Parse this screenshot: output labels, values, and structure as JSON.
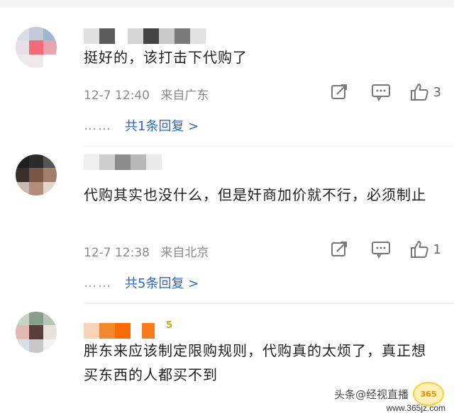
{
  "comments": [
    {
      "text": "挺好的，该打击下代购了",
      "time": "12-7 12:40",
      "location": "来自广东",
      "likes": "3",
      "reply_text": "共1条回复 >"
    },
    {
      "text": "代购其实也没什么，但是奸商加价就不行，必须制止",
      "time": "12-7 12:38",
      "location": "来自北京",
      "likes": "1",
      "reply_text": "共5条回复 >"
    },
    {
      "text": "胖东来应该制定限购规则，代购真的太烦了，真正想买东西的人都买不到",
      "badge": "5"
    }
  ],
  "reply_dots": "……",
  "watermark": {
    "text": "头条@经视直播",
    "url": "www.365jz.com",
    "logo": "365"
  },
  "colors": {
    "link": "#2a67c7",
    "meta": "#8a8a8a",
    "text": "#1f1f1f"
  },
  "icons": [
    "share-icon",
    "comment-icon",
    "thumb-up-icon"
  ]
}
